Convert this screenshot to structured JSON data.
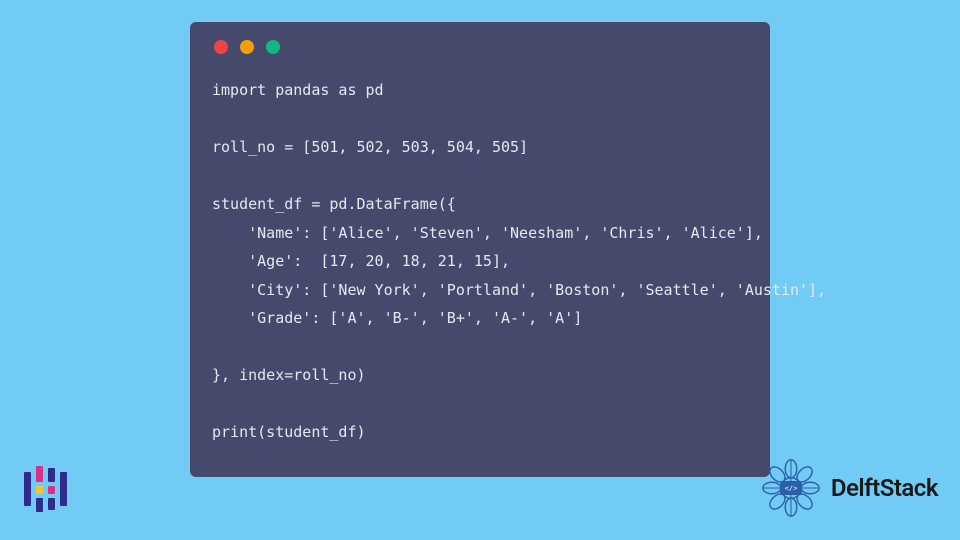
{
  "window": {
    "dots": [
      "red",
      "yellow",
      "green"
    ]
  },
  "code": {
    "lines": [
      "import pandas as pd",
      "",
      "roll_no = [501, 502, 503, 504, 505]",
      "",
      "student_df = pd.DataFrame({",
      "    'Name': ['Alice', 'Steven', 'Neesham', 'Chris', 'Alice'],",
      "    'Age':  [17, 20, 18, 21, 15],",
      "    'City': ['New York', 'Portland', 'Boston', 'Seattle', 'Austin'],",
      "    'Grade': ['A', 'B-', 'B+', 'A-', 'A']",
      "",
      "}, index=roll_no)",
      "",
      "print(student_df)"
    ],
    "text": "import pandas as pd\n\nroll_no = [501, 502, 503, 504, 505]\n\nstudent_df = pd.DataFrame({\n    'Name': ['Alice', 'Steven', 'Neesham', 'Chris', 'Alice'],\n    'Age':  [17, 20, 18, 21, 15],\n    'City': ['New York', 'Portland', 'Boston', 'Seattle', 'Austin'],\n    'Grade': ['A', 'B-', 'B+', 'A-', 'A']\n\n}, index=roll_no)\n\nprint(student_df)"
  },
  "brand": {
    "name": "DelftStack"
  },
  "colors": {
    "page_bg": "#71cbf5",
    "window_bg": "#454a6d",
    "code_fg": "#e6e7ef",
    "dot_red": "#ef4444",
    "dot_yellow": "#f59e0b",
    "dot_green": "#10b981",
    "mandala": "#2b5fa8"
  }
}
